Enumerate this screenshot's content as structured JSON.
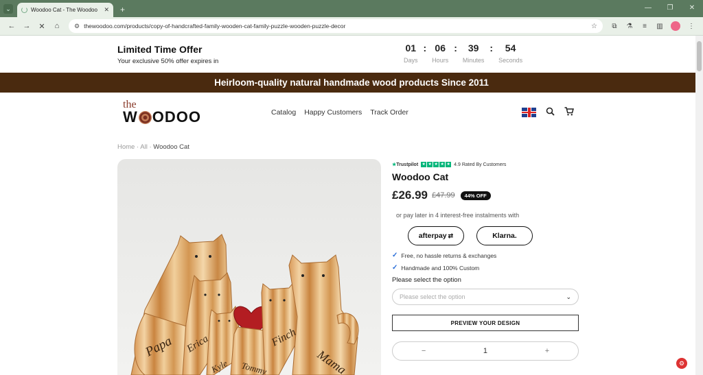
{
  "browser": {
    "tab_title": "Woodoo Cat - The Woodoo",
    "url": "thewoodoo.com/products/copy-of-handcrafted-family-wooden-cat-family-puzzle-wooden-puzzle-decor"
  },
  "offer": {
    "title": "Limited Time Offer",
    "subtitle": "Your exclusive 50% offer expires in",
    "countdown": [
      {
        "value": "01",
        "label": "Days"
      },
      {
        "value": "06",
        "label": "Hours"
      },
      {
        "value": "39",
        "label": "Minutes"
      },
      {
        "value": "54",
        "label": "Seconds"
      }
    ]
  },
  "banner": {
    "text": "Heirloom-quality natural handmade wood products Since 2011"
  },
  "header": {
    "logo_top": "the",
    "logo_pre": "W",
    "logo_post": "ODOO",
    "nav": [
      "Catalog",
      "Happy Customers",
      "Track Order"
    ]
  },
  "breadcrumb": {
    "items": [
      "Home",
      "All",
      "Woodoo Cat"
    ]
  },
  "gallery": {
    "names": [
      "Papa",
      "Erica",
      "Finch",
      "Mama",
      "Kyle",
      "Tommy"
    ]
  },
  "product": {
    "trustpilot": "Trustpilot",
    "rating_text": "4.9 Rated By Customers",
    "title": "Woodoo Cat",
    "price": "£26.99",
    "old_price": "£47.99",
    "discount": "44% OFF",
    "installments": "or pay later in 4 interest-free instalments with",
    "afterpay": "afterpay",
    "klarna": "Klarna.",
    "features": [
      "Free, no hassle returns & exchanges",
      "Handmade and 100% Custom"
    ],
    "option_label": "Please select the option",
    "option_placeholder": "Please select the option",
    "preview_label": "PREVIEW YOUR DESIGN",
    "quantity": "1"
  },
  "colors": {
    "banner": "#4a2a0f",
    "browser_chrome": "#5b7a5f",
    "trustpilot_green": "#00b67a"
  }
}
